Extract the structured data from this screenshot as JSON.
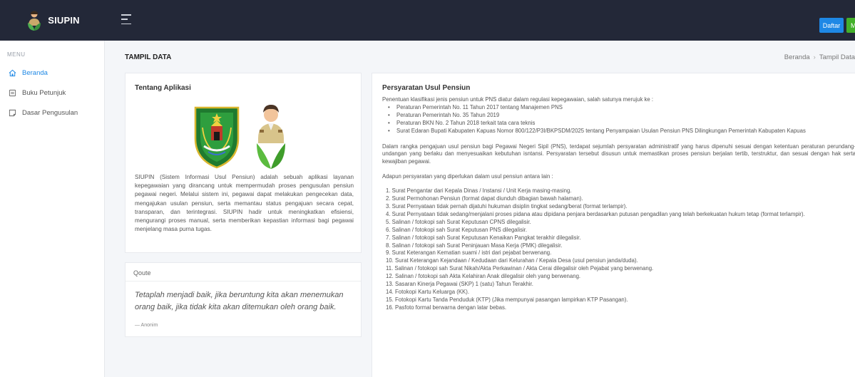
{
  "app": {
    "brand": "SIUPIN",
    "buttons": {
      "register": "Daftar",
      "login": "Masuk"
    }
  },
  "sidebar": {
    "menu_label": "MENU",
    "items": [
      {
        "label": "Beranda",
        "icon": "home-icon",
        "active": true
      },
      {
        "label": "Buku Petunjuk",
        "icon": "book-icon",
        "active": false
      },
      {
        "label": "Dasar Pengusulan",
        "icon": "document-icon",
        "active": false
      }
    ]
  },
  "header": {
    "title": "TAMPIL DATA",
    "breadcrumb": [
      "Beranda",
      "Tampil Data"
    ]
  },
  "about": {
    "title": "Tentang Aplikasi",
    "text": "SIUPIN (Sistem Informasi Usul Pensiun) adalah sebuah aplikasi layanan kepegawaian yang dirancang untuk mempermudah proses pengusulan pensiun pegawai negeri. Melalui sistem ini, pegawai dapat melakukan pengecekan data, mengajukan usulan pensiun, serta memantau status pengajuan secara cepat, transparan, dan terintegrasi. SIUPIN hadir untuk meningkatkan efisiensi, mengurangi proses manual, serta memberikan kepastian informasi bagi pegawai menjelang masa purna tugas."
  },
  "quote": {
    "header": "Qoute",
    "text": "Tetaplah menjadi baik, jika beruntung kita akan menemukan orang baik, jika tidak kita akan ditemukan oleh orang baik.",
    "author": "— Anonim"
  },
  "requirements": {
    "title": "Persyaratan Usul Pensiun",
    "intro": "Penentuan klasifikasi jenis pensiun untuk PNS diatur dalam regulasi kepegawaian, salah satunya merujuk ke :",
    "regulations": [
      "Peraturan Pemerintah No. 11 Tahun 2017 tentang Manajemen PNS",
      "Peraturan Pemerintah No. 35 Tahun 2019",
      "Peraturan BKN No. 2 Tahun 2018 terkait tata cara teknis",
      "Surat Edaran Bupati Kabupaten Kapuas Nomor 800/122/P3I/BKPSDM/2025 tentang Penyampaian Usulan Pensiun PNS Dilingkungan Pemerintah Kabupaten Kapuas"
    ],
    "paragraph": "Dalam rangka pengajuan usul pensiun bagi Pegawai Negeri Sipil (PNS), terdapat sejumlah persyaratan administratif yang harus dipenuhi sesuai dengan ketentuan peraturan perundang-undangan yang berlaku dan menyesuaikan kebutuhan isntansi. Persyaratan tersebut disusun untuk memastikan proses pensiun berjalan tertib, terstruktur, dan sesuai dengan hak serta kewajiban pegawai.",
    "list_intro": "Adapun persyaratan yang diperlukan dalam usul pensiun antara lain :",
    "items": [
      "1. Surat Pengantar dari Kepala Dinas / Instansi / Unit Kerja masing-masing.",
      "2. Surat Permohonan Pensiun (format dapat diunduh dibagian bawah halaman).",
      "3. Surat Pernyataan tidak pernah dijatuhi hukuman disiplin tingkat sedang/berat (format terlampir).",
      "4. Surat Pernyataan tidak sedang/menjalani proses pidana atau dipidana penjara berdasarkan putusan pengadilan yang telah berkekuatan hukum tetap (format terlampir).",
      "5. Salinan / fotokopi sah Surat Keputusan CPNS dilegalisir.",
      "6. Salinan / fotokopi sah Surat Keputusan PNS dilegalisir.",
      "7. Salinan / fotokopi sah Surat Keputusan Kenaikan Pangkat terakhir dilegalisir.",
      "8. Salinan / fotokopi sah Surat Peninjauan Masa Kerja (PMK) dilegalisir.",
      "9. Surat Keterangan Kematian suami / istri dari pejabat berwenang.",
      "10. Surat Keterangan Kejandaan / Kedudaan dari Kelurahan / Kepala Desa (usul pensiun janda/duda).",
      "11. Salinan / fotokopi sah Surat Nikah/Akta Perkawinan / Akta Cerai dilegalisir oleh Pejabat yang berwenang.",
      "12. Salinan / fotokopi sah Akta Kelahiran Anak dilegalisir oleh yang berwenang.",
      "13. Sasaran Kinerja Pegawai (SKP) 1 (satu) Tahun Terakhir.",
      "14. Fotokopi Kartu Keluarga (KK).",
      "15. Fotokopi Kartu Tanda Penduduk (KTP) (Jika mempunyai pasangan lampirkan KTP Pasangan).",
      "16. Pasfoto formal berwarna dengan latar bebas."
    ]
  },
  "colors": {
    "topbar": "#232838",
    "accent": "#1e88e5",
    "success": "#43b02a"
  }
}
